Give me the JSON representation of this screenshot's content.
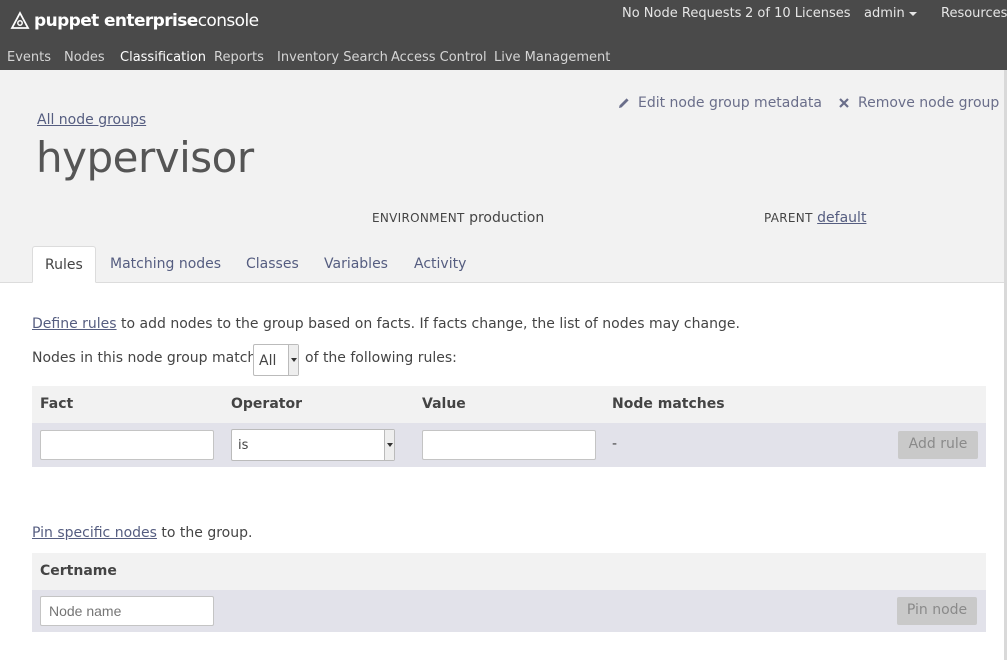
{
  "brand": {
    "bold": "puppet enterprise",
    "light": "console"
  },
  "topbar": {
    "node_requests": "No Node Requests",
    "licenses": "2 of 10 Licenses",
    "user": "admin",
    "resources": "Resources"
  },
  "nav": {
    "items": [
      "Events",
      "Nodes",
      "Classification",
      "Reports",
      "Inventory Search",
      "Access Control",
      "Live Management"
    ],
    "active": "Classification"
  },
  "header": {
    "breadcrumb": "All node groups",
    "title": "hypervisor",
    "edit_metadata": "Edit node group metadata",
    "remove_group": "Remove node group",
    "environment_label": "ENVIRONMENT",
    "environment_value": "production",
    "parent_label": "PARENT",
    "parent_value": "default"
  },
  "tabs": [
    "Rules",
    "Matching nodes",
    "Classes",
    "Variables",
    "Activity"
  ],
  "rules": {
    "define_link": "Define rules",
    "define_text": "to add nodes to the group based on facts. If facts change, the list of nodes may change.",
    "match_prefix": "Nodes in this node group match",
    "match_value": "All",
    "match_suffix": "of the following rules:",
    "columns": [
      "Fact",
      "Operator",
      "Value",
      "Node matches"
    ],
    "operator_value": "is",
    "node_matches": "-",
    "add_rule": "Add rule"
  },
  "pin": {
    "link": "Pin specific nodes",
    "text": "to the group.",
    "column": "Certname",
    "placeholder": "Node name",
    "button": "Pin node"
  },
  "colors": {
    "topbar": "#4a4a4a",
    "link": "#555d80",
    "row": "#e2e2ea"
  }
}
